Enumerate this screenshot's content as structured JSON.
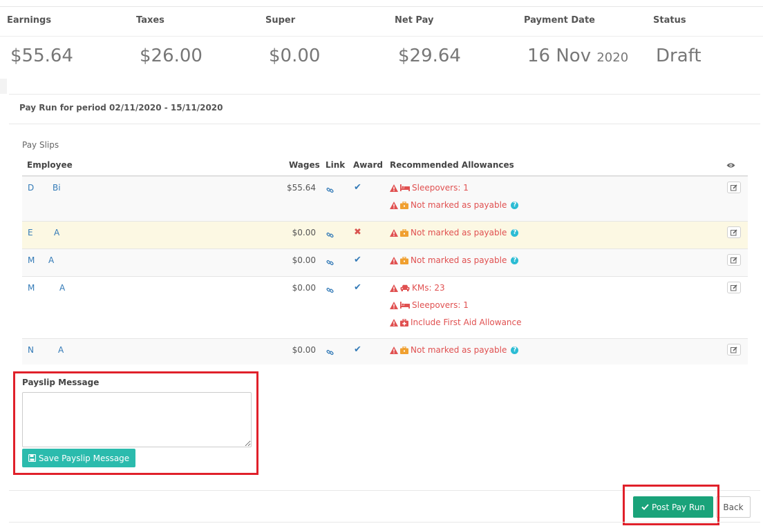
{
  "summary": {
    "earnings_label": "Earnings",
    "taxes_label": "Taxes",
    "super_label": "Super",
    "netpay_label": "Net Pay",
    "paydate_label": "Payment Date",
    "status_label": "Status",
    "earnings": "$55.64",
    "taxes": "$26.00",
    "super": "$0.00",
    "netpay": "$29.64",
    "paydate_day": "16 Nov",
    "paydate_year": "2020",
    "status": "Draft"
  },
  "period_title": "Pay Run for period 02/11/2020 - 15/11/2020",
  "payslips": {
    "label": "Pay Slips",
    "headers": {
      "employee": "Employee",
      "wages": "Wages",
      "link": "Link",
      "award": "Award",
      "allowances": "Recommended Allowances"
    },
    "rows": [
      {
        "first": "D",
        "last": "Bi",
        "wages": "$55.64",
        "award": "ok",
        "allowances": [
          {
            "icon": "bed-icon",
            "text": "Sleepovers: 1"
          },
          {
            "icon": "briefcase-icon",
            "text": "Not marked as payable",
            "help": true
          }
        ]
      },
      {
        "first": "E",
        "last": "A",
        "wages": "$0.00",
        "award": "no",
        "allowances": [
          {
            "icon": "briefcase-icon",
            "text": "Not marked as payable",
            "help": true
          }
        ]
      },
      {
        "first": "M",
        "last": "A",
        "wages": "$0.00",
        "award": "ok",
        "allowances": [
          {
            "icon": "briefcase-icon",
            "text": "Not marked as payable",
            "help": true
          }
        ]
      },
      {
        "first": "M",
        "last": "A",
        "wages": "$0.00",
        "award": "ok",
        "allowances": [
          {
            "icon": "car-icon",
            "text": "KMs: 23"
          },
          {
            "icon": "bed-icon",
            "text": "Sleepovers: 1"
          },
          {
            "icon": "medkit-icon",
            "text": "Include First Aid Allowance"
          }
        ]
      },
      {
        "first": "N",
        "last": "A",
        "wages": "$0.00",
        "award": "ok",
        "allowances": [
          {
            "icon": "briefcase-icon",
            "text": "Not marked as payable",
            "help": true
          }
        ]
      }
    ]
  },
  "payslip_message": {
    "label": "Payslip Message",
    "value": "",
    "save_label": "Save Payslip Message"
  },
  "footer": {
    "post_label": "Post Pay Run",
    "back_label": "Back"
  },
  "colors": {
    "danger": "#e05050",
    "accent_teal": "#2bbbad",
    "post_green": "#1aa37a",
    "highlight_red": "#e0202a",
    "link_blue": "#337ab7"
  }
}
